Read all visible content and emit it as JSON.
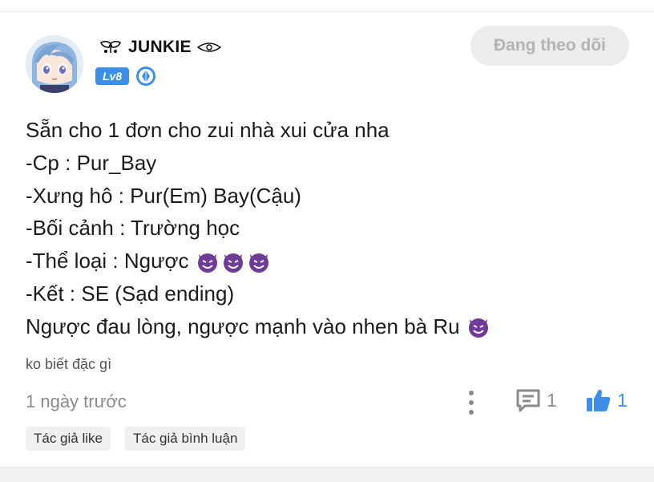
{
  "post": {
    "author": {
      "name": "JUNKIE",
      "level": "Lv8"
    },
    "follow_button": "Đang theo dõi",
    "content_lines": [
      "Sẵn cho 1 đơn cho zui nhà xui cửa nha",
      "-Cp : Pur_Bay",
      "-Xưng hô : Pur(Em) Bay(Cậu)",
      "-Bối cảnh : Trường học",
      "-Thể loại : Ngược",
      "-Kết : SE (Sạd ending)",
      "Ngược đau lòng, ngược mạnh vào nhen bà Ru"
    ],
    "note": "ko biết đặc gì",
    "timestamp": "1 ngày trước",
    "comment_count": "1",
    "like_count": "1",
    "tags": [
      "Tác giả like",
      "Tác giả bình luận"
    ]
  },
  "colors": {
    "accent_blue": "#3d8fe6",
    "muted_gray": "#8a8a8a",
    "emoji_purple": "#6f3b96"
  },
  "icons": {
    "author_prefix": "winged-symbol-icon",
    "author_suffix": "eye-symbol-icon",
    "role": "blue-gem-badge-icon",
    "emoji": "smiling-devil-emoji",
    "more": "vertical-dots-icon",
    "comment": "comment-icon",
    "like": "thumbs-up-icon"
  }
}
